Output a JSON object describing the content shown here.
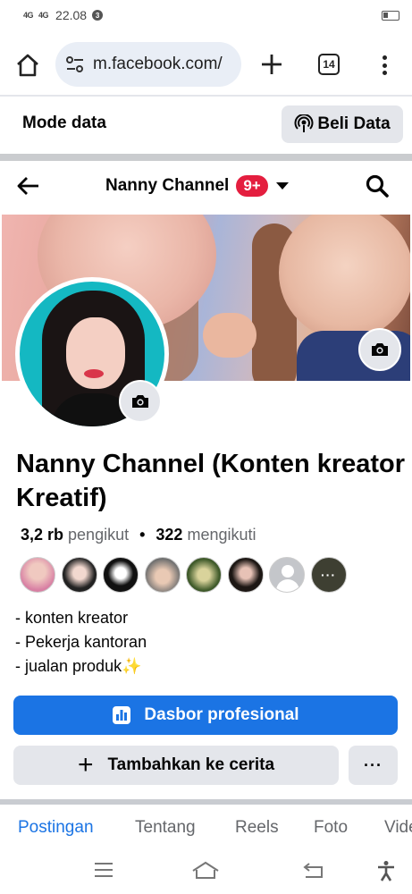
{
  "status_bar": {
    "signal1": "4G",
    "signal2": "4G",
    "time": "22.08",
    "notif": "3"
  },
  "browser": {
    "url": "m.facebook.com/",
    "tab_count": "14"
  },
  "mode_bar": {
    "label": "Mode data",
    "button": "Beli Data"
  },
  "header": {
    "title": "Nanny Channel",
    "badge": "9+"
  },
  "profile": {
    "name": "Nanny Channel (Konten kreator Kreatif)",
    "followers_count": "3,2 rb",
    "followers_label": "pengikut",
    "following_count": "322",
    "following_label": "mengikuti",
    "bio": [
      "- konten kreator",
      "- Pekerja kantoran",
      "- jualan produk✨"
    ]
  },
  "actions": {
    "professional": "Dasbor profesional",
    "add_story": "Tambahkan ke cerita",
    "more": "···"
  },
  "tabs": [
    "Postingan",
    "Tentang",
    "Reels",
    "Foto",
    "Video"
  ],
  "friends_more": "···",
  "colors": {
    "accent": "#1b74e4",
    "badge": "#e41e3f",
    "button_gray": "#e4e6eb"
  }
}
